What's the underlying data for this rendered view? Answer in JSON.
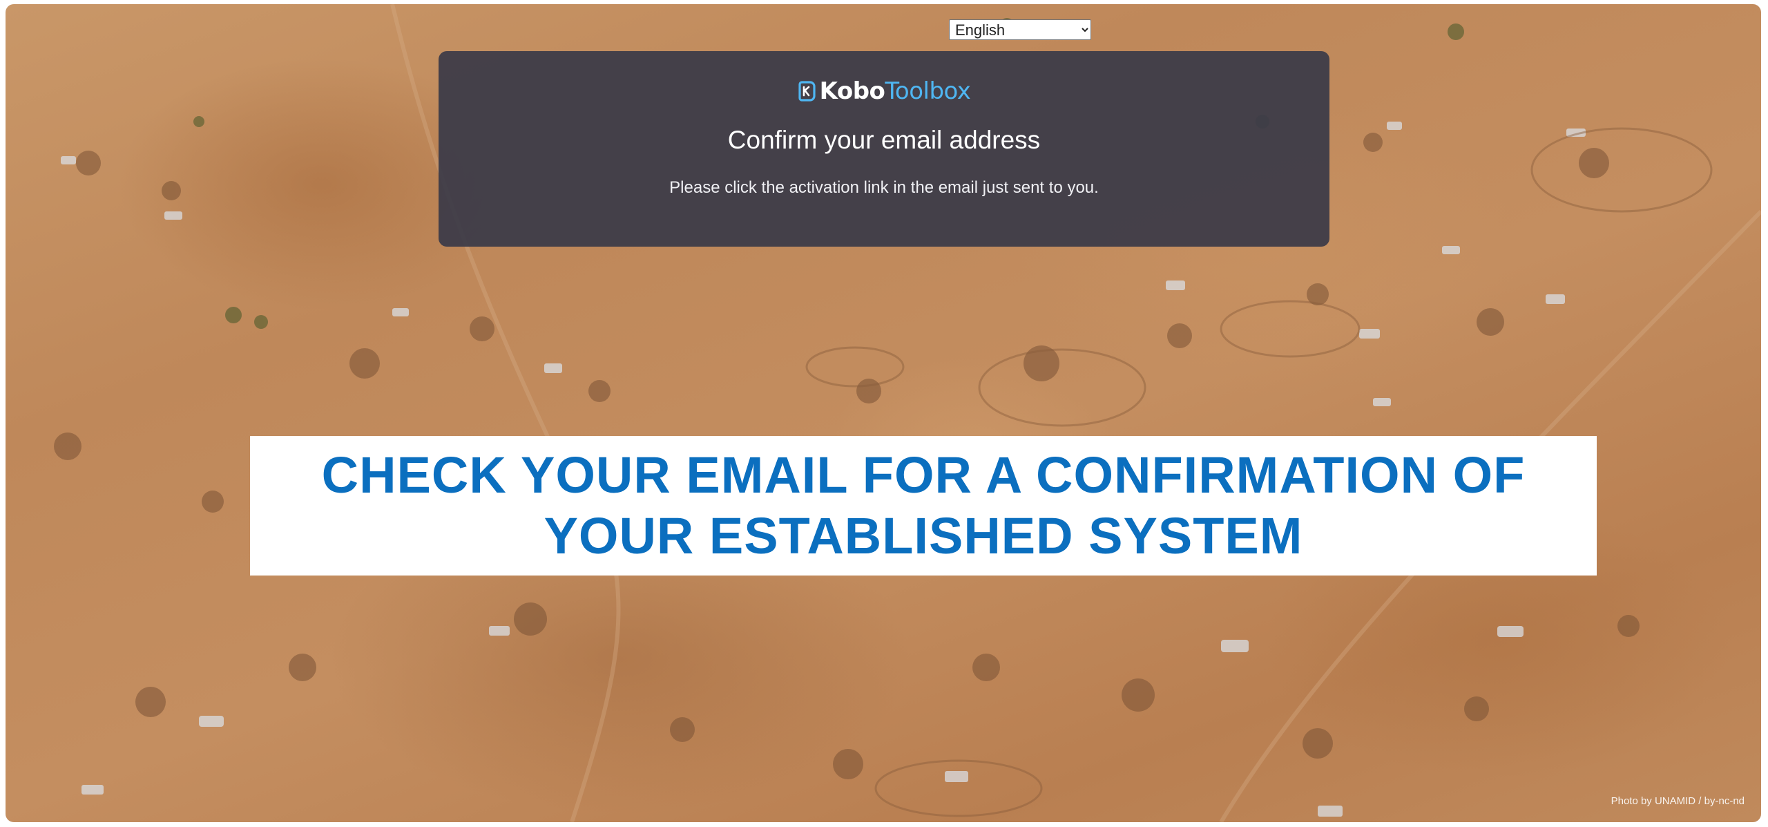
{
  "language_selector": {
    "selected": "English"
  },
  "modal": {
    "logo": {
      "part1": "Kobo",
      "part2": "Toolbox",
      "icon": "kobo-logo-icon"
    },
    "title": "Confirm your email address",
    "message": "Please click the activation link in the email just sent to you."
  },
  "banner": {
    "text": "CHECK YOUR EMAIL FOR A CONFIRMATION OF YOUR ESTABLISHED SYSTEM"
  },
  "photo_credit": "Photo by UNAMID / by-nc-nd",
  "colors": {
    "modal_bg": "#393a48",
    "logo_accent": "#4fb6f2",
    "banner_text": "#0b6fbf"
  }
}
